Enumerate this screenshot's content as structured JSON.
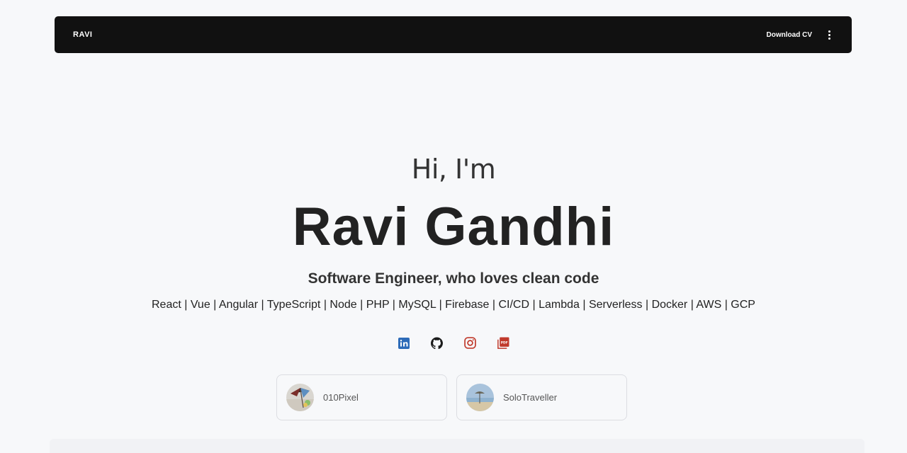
{
  "navbar": {
    "brand": "RAVI",
    "download_label": "Download CV",
    "menu_icon": "more-vert-icon"
  },
  "hero": {
    "greeting": "Hi, I'm",
    "name": "Ravi Gandhi",
    "tagline": "Software Engineer, who loves clean code",
    "skills": "React | Vue | Angular | TypeScript | Node | PHP | MySQL | Firebase | CI/CD | Lambda | Serverless | Docker | AWS | GCP"
  },
  "socials": [
    {
      "icon": "linkedin-icon",
      "color": "#2d6bb8"
    },
    {
      "icon": "github-icon",
      "color": "#1b1b1b"
    },
    {
      "icon": "instagram-icon",
      "color": "#c0392b"
    },
    {
      "icon": "pdf-icon",
      "color": "#c0392b"
    }
  ],
  "cards": [
    {
      "label": "010Pixel",
      "avatar": "umbrella-photo-avatar"
    },
    {
      "label": "SoloTraveller",
      "avatar": "beach-photo-avatar"
    }
  ]
}
